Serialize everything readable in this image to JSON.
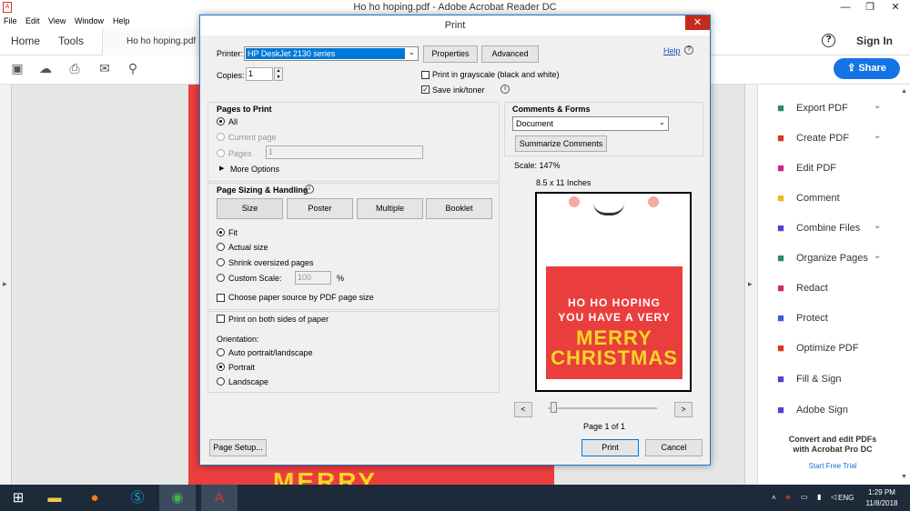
{
  "app": {
    "title": "Ho ho hoping.pdf - Adobe Acrobat Reader DC",
    "icon": "acrobat-icon",
    "minimize": "—",
    "restore": "❐",
    "close": "✕"
  },
  "menu": [
    "File",
    "Edit",
    "View",
    "Window",
    "Help"
  ],
  "nav": {
    "home": "Home",
    "tools": "Tools",
    "doc_tab": "Ho ho hoping.pdf",
    "help": "?",
    "signin": "Sign In"
  },
  "share": "Share",
  "background": {
    "merry": "MERRY"
  },
  "tools": [
    {
      "label": "Export PDF",
      "icon": "export-pdf-icon",
      "color": "#2d8f5b",
      "chevron": true
    },
    {
      "label": "Create PDF",
      "icon": "create-pdf-icon",
      "color": "#e0322a",
      "chevron": true
    },
    {
      "label": "Edit PDF",
      "icon": "edit-pdf-icon",
      "color": "#cc2a7d",
      "chevron": false
    },
    {
      "label": "Comment",
      "icon": "comment-icon",
      "color": "#f2b81d",
      "chevron": false
    },
    {
      "label": "Combine Files",
      "icon": "combine-files-icon",
      "color": "#5a3fd0",
      "chevron": true
    },
    {
      "label": "Organize Pages",
      "icon": "organize-pages-icon",
      "color": "#2d8f5b",
      "chevron": true
    },
    {
      "label": "Redact",
      "icon": "redact-icon",
      "color": "#cc2a7d",
      "chevron": false
    },
    {
      "label": "Protect",
      "icon": "protect-icon",
      "color": "#3b5fd0",
      "chevron": false
    },
    {
      "label": "Optimize PDF",
      "icon": "optimize-pdf-icon",
      "color": "#e0322a",
      "chevron": false
    },
    {
      "label": "Fill & Sign",
      "icon": "fill-sign-icon",
      "color": "#5a3fd0",
      "chevron": false
    },
    {
      "label": "Adobe Sign",
      "icon": "adobe-sign-icon",
      "color": "#5a3fd0",
      "chevron": false
    }
  ],
  "promo": {
    "line1": "Convert and edit PDFs",
    "line2": "with Acrobat Pro DC",
    "link": "Start Free Trial"
  },
  "dialog": {
    "title": "Print",
    "printer_label": "Printer:",
    "printer": "HP DeskJet 2130 series",
    "properties": "Properties",
    "advanced": "Advanced",
    "help": "Help",
    "copies_label": "Copies:",
    "copies": "1",
    "grayscale": "Print in grayscale (black and white)",
    "save_ink": "Save ink/toner",
    "pages_header": "Pages to Print",
    "all": "All",
    "current": "Current page",
    "pages": "Pages",
    "pages_value": "1",
    "more": "More Options",
    "sizing_header": "Page Sizing & Handling",
    "size": "Size",
    "poster": "Poster",
    "multiple": "Multiple",
    "booklet": "Booklet",
    "fit": "Fit",
    "actual": "Actual size",
    "shrink": "Shrink oversized pages",
    "custom": "Custom Scale:",
    "custom_value": "100",
    "percent": "%",
    "paper_source": "Choose paper source by PDF page size",
    "both_sides": "Print on both sides of paper",
    "orientation": "Orientation:",
    "auto": "Auto portrait/landscape",
    "portrait": "Portrait",
    "landscape": "Landscape",
    "comments_header": "Comments & Forms",
    "comments_value": "Document",
    "summarize": "Summarize Comments",
    "scale": "Scale: 147%",
    "paper": "8.5 x 11 Inches",
    "prev": "<",
    "next": ">",
    "page_of": "Page 1 of 1",
    "page_setup": "Page Setup...",
    "print": "Print",
    "cancel": "Cancel"
  },
  "preview": {
    "line1": "HO HO HOPING",
    "line2": "YOU HAVE A VERY",
    "line3": "MERRY",
    "line4": "CHRISTMAS"
  },
  "taskbar": {
    "lang": "ENG",
    "time": "1:29 PM",
    "date": "11/8/2018"
  }
}
